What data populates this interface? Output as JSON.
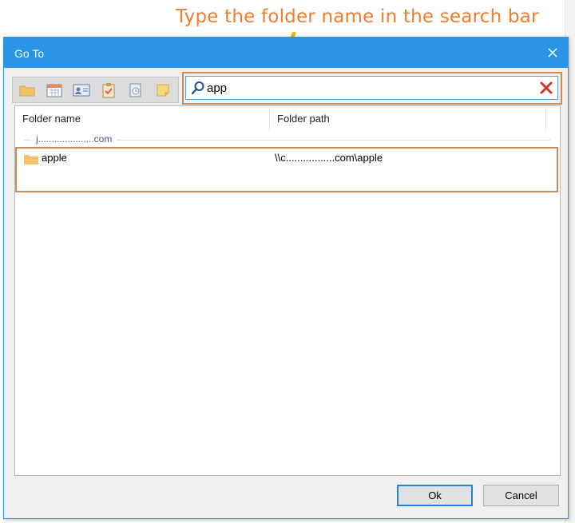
{
  "annotation": {
    "text": "Type the folder name in the search bar",
    "color": "#ed7d31"
  },
  "dialog": {
    "title": "Go To",
    "titlebar_color": "#2a95e6",
    "toolbar": {
      "buttons": [
        "folder-icon",
        "calendar-icon",
        "contacts-icon",
        "tasks-icon",
        "journal-icon",
        "notes-icon"
      ]
    },
    "search": {
      "value": "app",
      "placeholder": ""
    },
    "list": {
      "columns": [
        "Folder name",
        "Folder path"
      ],
      "group_label": "j.....................com",
      "rows": [
        {
          "name": "apple",
          "path": "\\\\c.................com\\apple"
        }
      ]
    },
    "buttons": {
      "ok": "Ok",
      "cancel": "Cancel"
    }
  }
}
